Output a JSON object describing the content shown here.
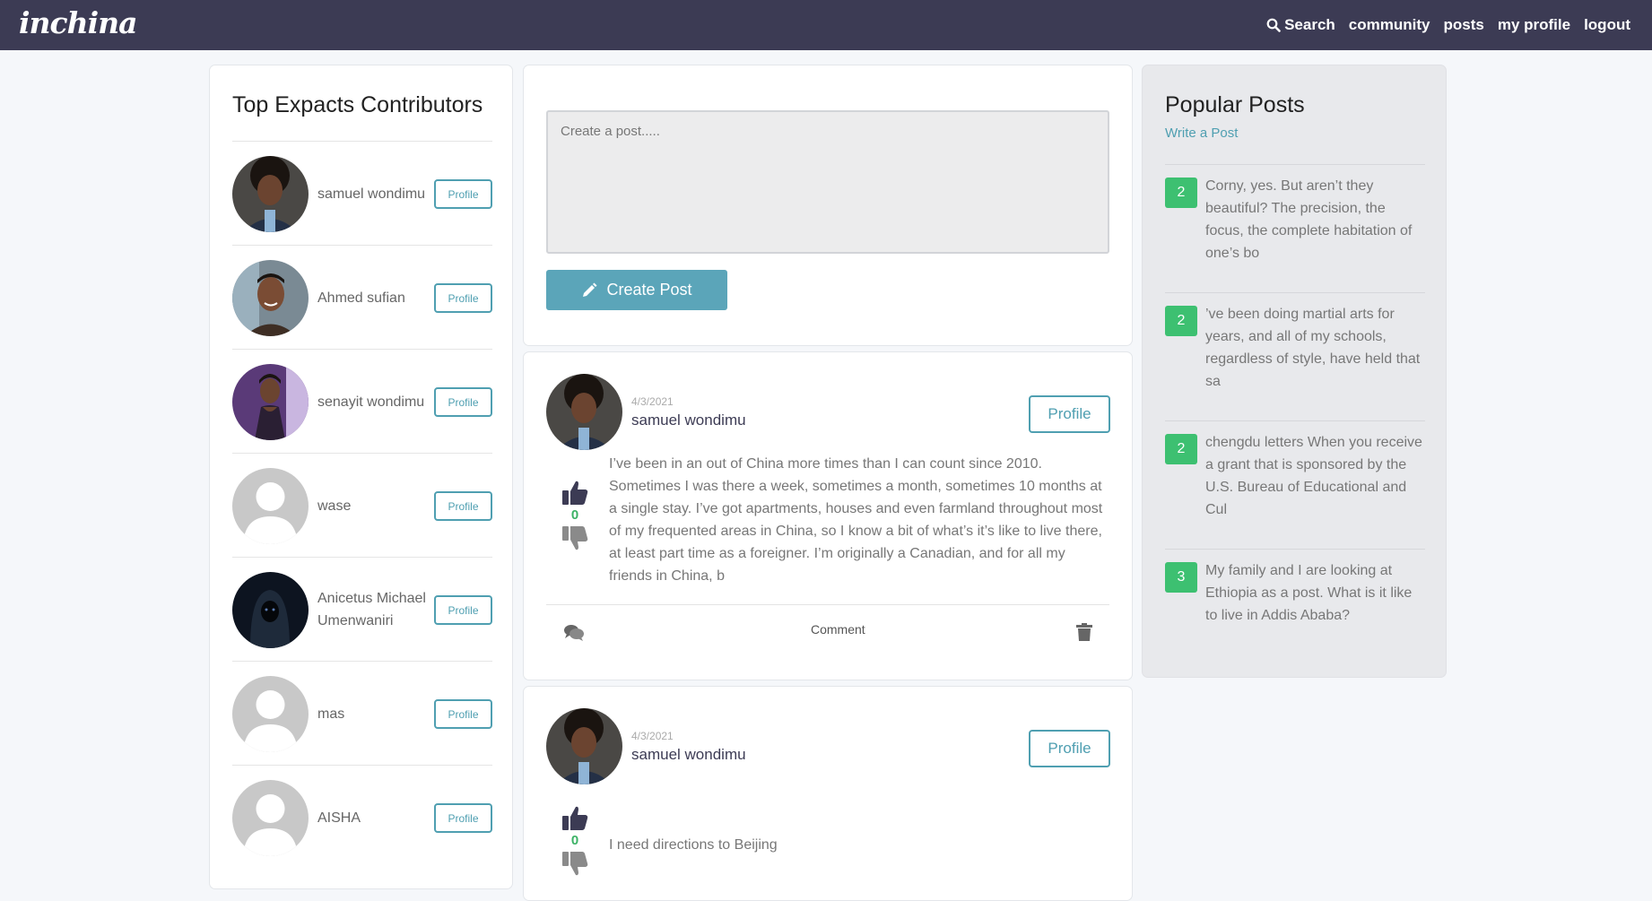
{
  "nav": {
    "brand": "inchina",
    "search_label": "Search",
    "links": [
      "community",
      "posts",
      "my profile",
      "logout"
    ]
  },
  "contributors": {
    "title": "Top Expacts Contributors",
    "button_label": "Profile",
    "items": [
      {
        "name": "samuel wondimu",
        "avatar": "photo"
      },
      {
        "name": "Ahmed sufian",
        "avatar": "photo"
      },
      {
        "name": "senayit wondimu",
        "avatar": "photo"
      },
      {
        "name": "wase",
        "avatar": "default"
      },
      {
        "name": "Anicetus Michael Umenwaniri",
        "avatar": "photo-dark"
      },
      {
        "name": "mas",
        "avatar": "default"
      },
      {
        "name": "AISHA",
        "avatar": "default"
      }
    ]
  },
  "composer": {
    "placeholder": "Create a post.....",
    "button_label": "Create Post"
  },
  "posts": [
    {
      "date": "4/3/2021",
      "author": "samuel wondimu",
      "profile_label": "Profile",
      "votes": "0",
      "body": "I’ve been in an out of China more times than I can count since 2010. Sometimes I was there a week, sometimes a month, sometimes 10 months at a single stay. I’ve got apartments, houses and even farmland throughout most of my frequented areas in China, so I know a bit of what’s it’s like to live there, at least part time as a foreigner. I’m originally a Canadian, and for all my friends in China, b",
      "comment_label": "Comment"
    },
    {
      "date": "4/3/2021",
      "author": "samuel wondimu",
      "profile_label": "Profile",
      "votes": "0",
      "body": "I need directions to Beijing"
    }
  ],
  "popular": {
    "title": "Popular Posts",
    "write_label": "Write a Post",
    "items": [
      {
        "count": "2",
        "text": "Corny, yes. But aren’t they beautiful? The precision, the focus, the complete habitation of one’s bo"
      },
      {
        "count": "2",
        "text": "’ve been doing martial arts for years, and all of my schools, regardless of style, have held that sa"
      },
      {
        "count": "2",
        "text": "chengdu letters When you receive a grant that is sponsored by the U.S. Bureau of Educational and Cul"
      },
      {
        "count": "3",
        "text": "My family and I are looking at Ethiopia as a post. What is it like to live in Addis Ababa?"
      }
    ]
  },
  "colors": {
    "navbar": "#3c3b54",
    "accent": "#4f9fb1",
    "badge": "#3dc071"
  }
}
